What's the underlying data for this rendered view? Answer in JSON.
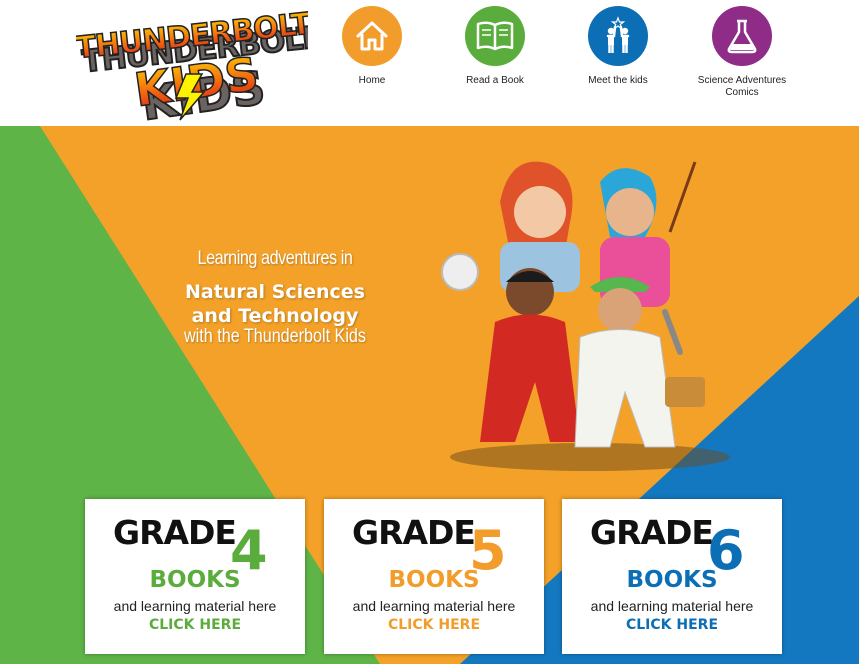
{
  "colors": {
    "orange": "#f29d2b",
    "green": "#5aac3c",
    "blue": "#0c6fb5",
    "purple": "#8e2c88",
    "hero_orange": "#f3a128",
    "hero_green": "#5fb447",
    "hero_blue": "#1478c0"
  },
  "logo": {
    "line1": "THUNDERBOLT",
    "line2": "KIDS"
  },
  "nav": [
    {
      "label": "Home",
      "icon": "home-icon",
      "color": "#f29d2b"
    },
    {
      "label": "Read a Book",
      "icon": "open-book-icon",
      "color": "#5aac3c"
    },
    {
      "label": "Meet the kids",
      "icon": "kids-high-five-icon",
      "color": "#0c6fb5"
    },
    {
      "label": "Science Adventures Comics",
      "icon": "flask-icon",
      "color": "#8e2c88"
    }
  ],
  "hero": {
    "line1": "Learning adventures in",
    "line2": "Natural Sciences",
    "line3": "and Technology",
    "line4": "with the Thunderbolt Kids"
  },
  "cards": [
    {
      "grade": "GRADE",
      "number": "4",
      "books": "BOOKS",
      "sub": "and learning material here",
      "cta": "CLICK HERE",
      "color": "#5aac3c"
    },
    {
      "grade": "GRADE",
      "number": "5",
      "books": "BOOKS",
      "sub": "and learning material here",
      "cta": "CLICK HERE",
      "color": "#f29d2b"
    },
    {
      "grade": "GRADE",
      "number": "6",
      "books": "BOOKS",
      "sub": "and learning material here",
      "cta": "CLICK HERE",
      "color": "#0c6fb5"
    }
  ]
}
